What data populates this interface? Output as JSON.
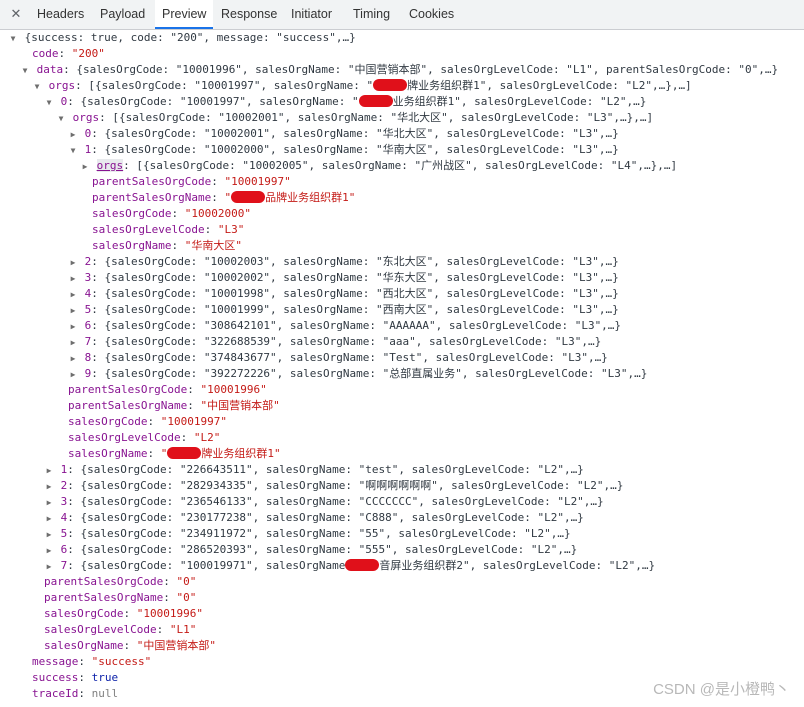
{
  "tabs": [
    {
      "label": "Headers",
      "active": false
    },
    {
      "label": "Payload",
      "active": false
    },
    {
      "label": "Preview",
      "active": true
    },
    {
      "label": "Response",
      "active": false
    },
    {
      "label": "Initiator",
      "active": false
    },
    {
      "label": "Timing",
      "active": false
    },
    {
      "label": "Cookies",
      "active": false
    }
  ],
  "close_glyph": "✕",
  "rows": [
    {
      "indent": 0,
      "tri": "down",
      "parts": [
        [
          "p",
          "{success: true, code: \"200\", message: \"success\",…}"
        ]
      ]
    },
    {
      "indent": 1,
      "parts": [
        [
          "k",
          "code"
        ],
        [
          "p",
          ": "
        ],
        [
          "s",
          "\"200\""
        ]
      ]
    },
    {
      "indent": 1,
      "tri": "down",
      "parts": [
        [
          "k",
          "data"
        ],
        [
          "p",
          ": {salesOrgCode: \"10001996\", salesOrgName: \"中国营销本部\", salesOrgLevelCode: \"L1\", parentSalesOrgCode: \"0\",…}"
        ]
      ]
    },
    {
      "indent": 2,
      "tri": "down",
      "parts": [
        [
          "k",
          "orgs"
        ],
        [
          "p",
          ": [{salesOrgCode: \"10001997\", salesOrgName: \""
        ],
        [
          "redact",
          ""
        ],
        [
          "p",
          "牌业务组织群1\", salesOrgLevelCode: \"L2\",…},…]"
        ]
      ]
    },
    {
      "indent": 3,
      "tri": "down",
      "parts": [
        [
          "k",
          "0"
        ],
        [
          "p",
          ": {salesOrgCode: \"10001997\", salesOrgName: \""
        ],
        [
          "redact",
          ""
        ],
        [
          "p",
          "业务组织群1\", salesOrgLevelCode: \"L2\",…}"
        ]
      ]
    },
    {
      "indent": 4,
      "tri": "down",
      "parts": [
        [
          "k",
          "orgs"
        ],
        [
          "p",
          ": [{salesOrgCode: \"10002001\", salesOrgName: \"华北大区\", salesOrgLevelCode: \"L3\",…},…]"
        ]
      ]
    },
    {
      "indent": 5,
      "tri": "right",
      "parts": [
        [
          "k",
          "0"
        ],
        [
          "p",
          ": {salesOrgCode: \"10002001\", salesOrgName: \"华北大区\", salesOrgLevelCode: \"L3\",…}"
        ]
      ]
    },
    {
      "indent": 5,
      "tri": "down",
      "parts": [
        [
          "k",
          "1"
        ],
        [
          "p",
          ": {salesOrgCode: \"10002000\", salesOrgName: \"华南大区\", salesOrgLevelCode: \"L3\",…}"
        ]
      ]
    },
    {
      "indent": 6,
      "tri": "right",
      "sel": true,
      "parts": [
        [
          "ku",
          "orgs"
        ],
        [
          "p",
          ": [{salesOrgCode: \"10002005\", salesOrgName: \"广州战区\", salesOrgLevelCode: \"L4\",…},…]"
        ]
      ]
    },
    {
      "indent": 6,
      "parts": [
        [
          "k",
          "parentSalesOrgCode"
        ],
        [
          "p",
          ": "
        ],
        [
          "s",
          "\"10001997\""
        ]
      ]
    },
    {
      "indent": 6,
      "parts": [
        [
          "k",
          "parentSalesOrgName"
        ],
        [
          "p",
          ": "
        ],
        [
          "s",
          "\""
        ],
        [
          "redact",
          ""
        ],
        [
          "s",
          "品牌业务组织群1\""
        ]
      ]
    },
    {
      "indent": 6,
      "parts": [
        [
          "k",
          "salesOrgCode"
        ],
        [
          "p",
          ": "
        ],
        [
          "s",
          "\"10002000\""
        ]
      ]
    },
    {
      "indent": 6,
      "parts": [
        [
          "k",
          "salesOrgLevelCode"
        ],
        [
          "p",
          ": "
        ],
        [
          "s",
          "\"L3\""
        ]
      ]
    },
    {
      "indent": 6,
      "parts": [
        [
          "k",
          "salesOrgName"
        ],
        [
          "p",
          ": "
        ],
        [
          "s",
          "\"华南大区\""
        ]
      ]
    },
    {
      "indent": 5,
      "tri": "right",
      "parts": [
        [
          "k",
          "2"
        ],
        [
          "p",
          ": {salesOrgCode: \"10002003\", salesOrgName: \"东北大区\", salesOrgLevelCode: \"L3\",…}"
        ]
      ]
    },
    {
      "indent": 5,
      "tri": "right",
      "parts": [
        [
          "k",
          "3"
        ],
        [
          "p",
          ": {salesOrgCode: \"10002002\", salesOrgName: \"华东大区\", salesOrgLevelCode: \"L3\",…}"
        ]
      ]
    },
    {
      "indent": 5,
      "tri": "right",
      "parts": [
        [
          "k",
          "4"
        ],
        [
          "p",
          ": {salesOrgCode: \"10001998\", salesOrgName: \"西北大区\", salesOrgLevelCode: \"L3\",…}"
        ]
      ]
    },
    {
      "indent": 5,
      "tri": "right",
      "parts": [
        [
          "k",
          "5"
        ],
        [
          "p",
          ": {salesOrgCode: \"10001999\", salesOrgName: \"西南大区\", salesOrgLevelCode: \"L3\",…}"
        ]
      ]
    },
    {
      "indent": 5,
      "tri": "right",
      "parts": [
        [
          "k",
          "6"
        ],
        [
          "p",
          ": {salesOrgCode: \"308642101\", salesOrgName: \"AAAAAA\", salesOrgLevelCode: \"L3\",…}"
        ]
      ]
    },
    {
      "indent": 5,
      "tri": "right",
      "parts": [
        [
          "k",
          "7"
        ],
        [
          "p",
          ": {salesOrgCode: \"322688539\", salesOrgName: \"aaa\", salesOrgLevelCode: \"L3\",…}"
        ]
      ]
    },
    {
      "indent": 5,
      "tri": "right",
      "parts": [
        [
          "k",
          "8"
        ],
        [
          "p",
          ": {salesOrgCode: \"374843677\", salesOrgName: \"Test\", salesOrgLevelCode: \"L3\",…}"
        ]
      ]
    },
    {
      "indent": 5,
      "tri": "right",
      "parts": [
        [
          "k",
          "9"
        ],
        [
          "p",
          ": {salesOrgCode: \"392272226\", salesOrgName: \"总部直属业务\", salesOrgLevelCode: \"L3\",…}"
        ]
      ]
    },
    {
      "indent": 4,
      "parts": [
        [
          "k",
          "parentSalesOrgCode"
        ],
        [
          "p",
          ": "
        ],
        [
          "s",
          "\"10001996\""
        ]
      ]
    },
    {
      "indent": 4,
      "parts": [
        [
          "k",
          "parentSalesOrgName"
        ],
        [
          "p",
          ": "
        ],
        [
          "s",
          "\"中国营销本部\""
        ]
      ]
    },
    {
      "indent": 4,
      "parts": [
        [
          "k",
          "salesOrgCode"
        ],
        [
          "p",
          ": "
        ],
        [
          "s",
          "\"10001997\""
        ]
      ]
    },
    {
      "indent": 4,
      "parts": [
        [
          "k",
          "salesOrgLevelCode"
        ],
        [
          "p",
          ": "
        ],
        [
          "s",
          "\"L2\""
        ]
      ]
    },
    {
      "indent": 4,
      "parts": [
        [
          "k",
          "salesOrgName"
        ],
        [
          "p",
          ": "
        ],
        [
          "s",
          "\""
        ],
        [
          "redact",
          ""
        ],
        [
          "s",
          "牌业务组织群1\""
        ]
      ]
    },
    {
      "indent": 3,
      "tri": "right",
      "parts": [
        [
          "k",
          "1"
        ],
        [
          "p",
          ": {salesOrgCode: \"226643511\", salesOrgName: \"test\", salesOrgLevelCode: \"L2\",…}"
        ]
      ]
    },
    {
      "indent": 3,
      "tri": "right",
      "parts": [
        [
          "k",
          "2"
        ],
        [
          "p",
          ": {salesOrgCode: \"282934335\", salesOrgName: \"啊啊啊啊啊啊\", salesOrgLevelCode: \"L2\",…}"
        ]
      ]
    },
    {
      "indent": 3,
      "tri": "right",
      "parts": [
        [
          "k",
          "3"
        ],
        [
          "p",
          ": {salesOrgCode: \"236546133\", salesOrgName: \"CCCCCCC\", salesOrgLevelCode: \"L2\",…}"
        ]
      ]
    },
    {
      "indent": 3,
      "tri": "right",
      "parts": [
        [
          "k",
          "4"
        ],
        [
          "p",
          ": {salesOrgCode: \"230177238\", salesOrgName: \"C888\", salesOrgLevelCode: \"L2\",…}"
        ]
      ]
    },
    {
      "indent": 3,
      "tri": "right",
      "parts": [
        [
          "k",
          "5"
        ],
        [
          "p",
          ": {salesOrgCode: \"234911972\", salesOrgName: \"55\", salesOrgLevelCode: \"L2\",…}"
        ]
      ]
    },
    {
      "indent": 3,
      "tri": "right",
      "parts": [
        [
          "k",
          "6"
        ],
        [
          "p",
          ": {salesOrgCode: \"286520393\", salesOrgName: \"555\", salesOrgLevelCode: \"L2\",…}"
        ]
      ]
    },
    {
      "indent": 3,
      "tri": "right",
      "parts": [
        [
          "k",
          "7"
        ],
        [
          "p",
          ": {salesOrgCode: \"100019971\", salesOrgName"
        ],
        [
          "redact",
          ""
        ],
        [
          "p",
          "音屏业务组织群2\", salesOrgLevelCode: \"L2\",…}"
        ]
      ]
    },
    {
      "indent": 2,
      "parts": [
        [
          "k",
          "parentSalesOrgCode"
        ],
        [
          "p",
          ": "
        ],
        [
          "s",
          "\"0\""
        ]
      ]
    },
    {
      "indent": 2,
      "parts": [
        [
          "k",
          "parentSalesOrgName"
        ],
        [
          "p",
          ": "
        ],
        [
          "s",
          "\"0\""
        ]
      ]
    },
    {
      "indent": 2,
      "parts": [
        [
          "k",
          "salesOrgCode"
        ],
        [
          "p",
          ": "
        ],
        [
          "s",
          "\"10001996\""
        ]
      ]
    },
    {
      "indent": 2,
      "parts": [
        [
          "k",
          "salesOrgLevelCode"
        ],
        [
          "p",
          ": "
        ],
        [
          "s",
          "\"L1\""
        ]
      ]
    },
    {
      "indent": 2,
      "parts": [
        [
          "k",
          "salesOrgName"
        ],
        [
          "p",
          ": "
        ],
        [
          "s",
          "\"中国营销本部\""
        ]
      ]
    },
    {
      "indent": 1,
      "parts": [
        [
          "k",
          "message"
        ],
        [
          "p",
          ": "
        ],
        [
          "s",
          "\"success\""
        ]
      ]
    },
    {
      "indent": 1,
      "parts": [
        [
          "k",
          "success"
        ],
        [
          "p",
          ": "
        ],
        [
          "b",
          "true"
        ]
      ]
    },
    {
      "indent": 1,
      "parts": [
        [
          "k",
          "traceId"
        ],
        [
          "p",
          ": "
        ],
        [
          "nul",
          "null"
        ]
      ]
    }
  ],
  "watermark": "CSDN @是小橙鸭丶",
  "colors": {
    "key": "#881391",
    "string": "#c41a16",
    "keyword": "#0d22aa",
    "null": "#808080",
    "redaction": "#e0101a",
    "active_tab_underline": "#1a73e8"
  }
}
